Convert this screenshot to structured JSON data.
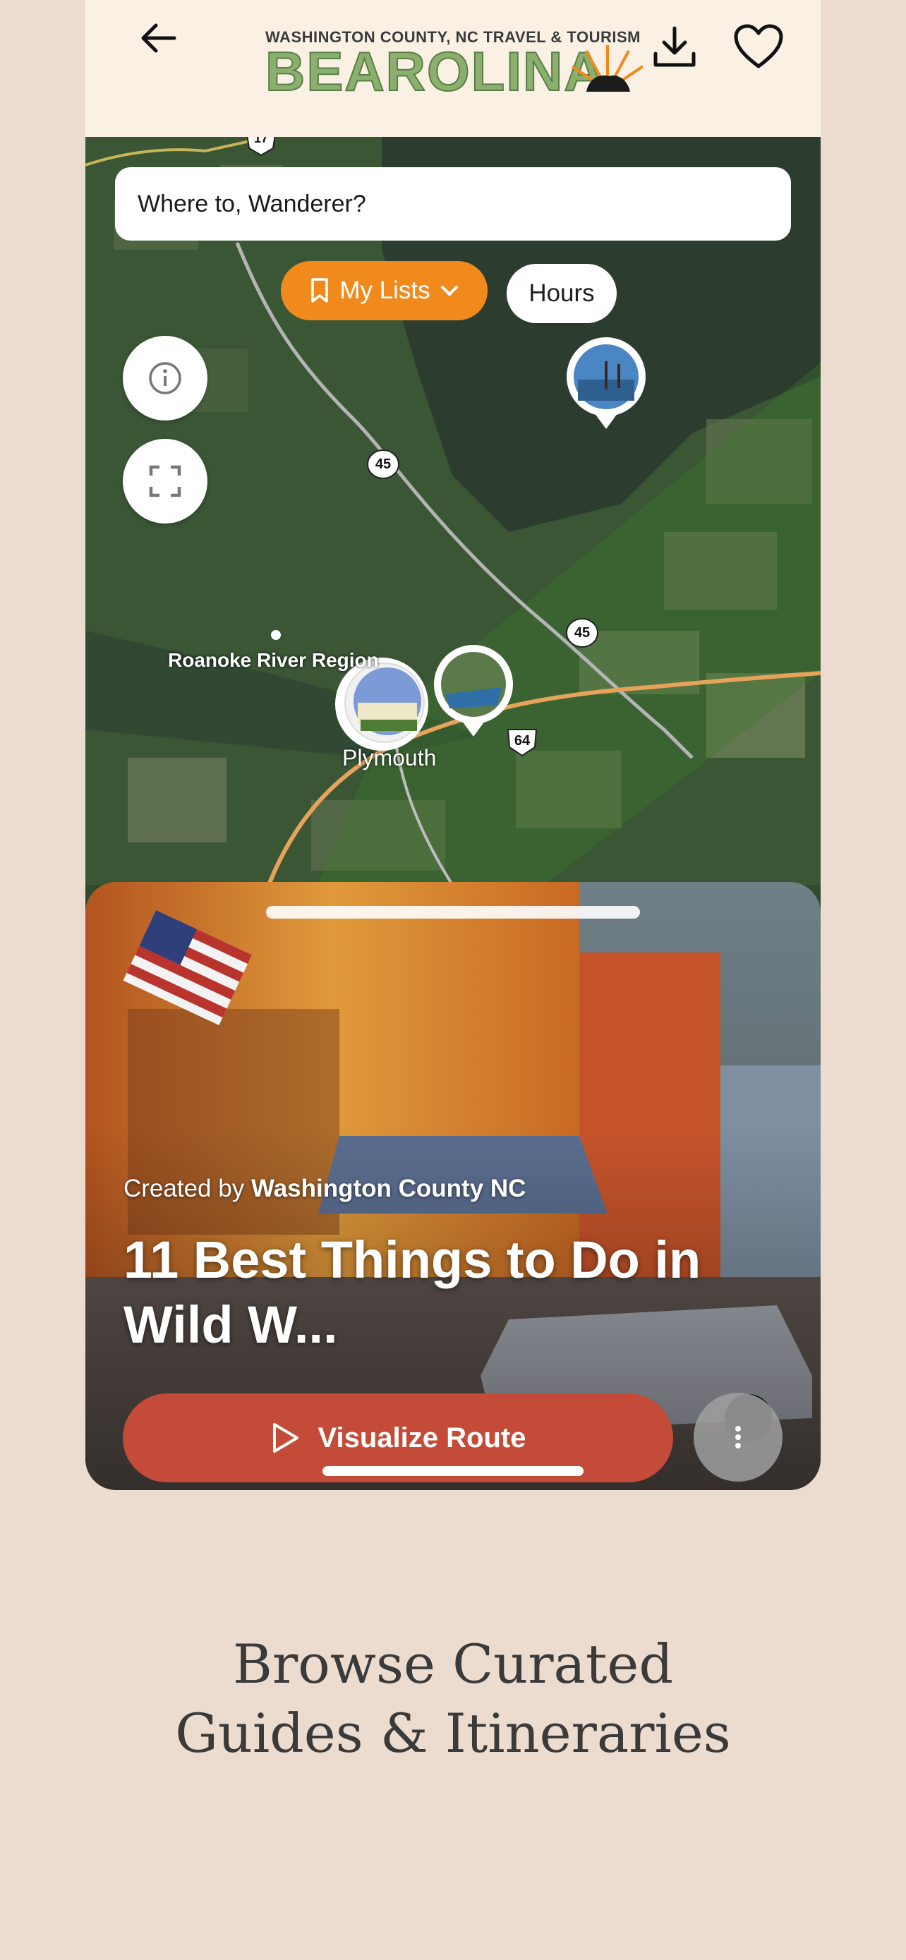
{
  "header": {
    "logo_tagline": "WASHINGTON COUNTY, NC TRAVEL & TOURISM",
    "logo_wordmark": "BEAROLINA",
    "icons": [
      "back-arrow-icon",
      "download-icon",
      "heart-icon"
    ]
  },
  "map": {
    "search_placeholder": "Where to, Wanderer?",
    "my_lists_label": "My Lists",
    "hours_label": "Hours",
    "region_label": "Roanoke River Region",
    "town_label": "Plymouth",
    "route_shields": [
      "17",
      "45",
      "45",
      "64"
    ],
    "colors": {
      "orange": "#f08a1c",
      "map_green": "#2f4a2d"
    }
  },
  "card": {
    "created_by_prefix": "Created by",
    "created_by_name": "Washington County NC",
    "title": "11 Best Things to Do in Wild W...",
    "visualize_label": "Visualize Route",
    "colors": {
      "button_red": "#c44b37"
    }
  },
  "caption": {
    "line1": "Browse Curated",
    "line2": "Guides & Itineraries"
  }
}
